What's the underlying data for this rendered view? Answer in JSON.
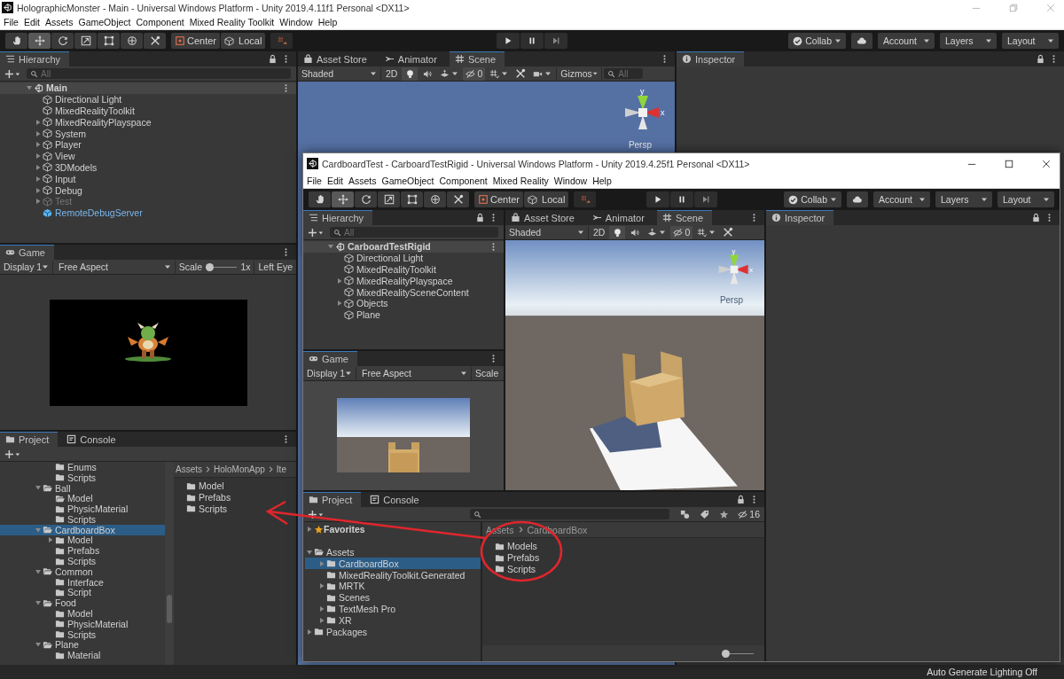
{
  "back_window": {
    "title": "HolographicMonster - Main - Universal Windows Platform - Unity 2019.4.11f1 Personal <DX11>",
    "menu": [
      "File",
      "Edit",
      "Assets",
      "GameObject",
      "Component",
      "Mixed Reality Toolkit",
      "Window",
      "Help"
    ],
    "tools": [
      {
        "kind": "hand",
        "selected": false
      },
      {
        "kind": "move",
        "selected": true
      },
      {
        "kind": "rotate",
        "selected": false
      },
      {
        "kind": "scale",
        "selected": false
      },
      {
        "kind": "rect",
        "selected": false
      },
      {
        "kind": "transform",
        "selected": false
      },
      {
        "kind": "custom",
        "selected": false
      }
    ],
    "pivot": "Center",
    "space": "Local",
    "collab": "Collab",
    "account": "Account",
    "layers": "Layers",
    "layout": "Layout",
    "hierarchy": {
      "title": "Hierarchy",
      "search_placeholder": "All",
      "scene": "Main",
      "items": [
        {
          "label": "Directional Light",
          "kind": "object",
          "disabled": false,
          "selected": false
        },
        {
          "label": "MixedRealityToolkit",
          "kind": "object",
          "disabled": false,
          "selected": false
        },
        {
          "label": "MixedRealityPlayspace",
          "kind": "object",
          "expanded": false,
          "disabled": false,
          "selected": false
        },
        {
          "label": "System",
          "kind": "object",
          "expanded": false,
          "disabled": false,
          "selected": false
        },
        {
          "label": "Player",
          "kind": "object",
          "expanded": false,
          "disabled": false,
          "selected": false
        },
        {
          "label": "View",
          "kind": "object",
          "expanded": false,
          "disabled": false,
          "selected": false
        },
        {
          "label": "3DModels",
          "kind": "object",
          "expanded": false,
          "disabled": false,
          "selected": false
        },
        {
          "label": "Input",
          "kind": "object",
          "expanded": false,
          "disabled": false,
          "selected": false
        },
        {
          "label": "Debug",
          "kind": "object",
          "expanded": false,
          "disabled": false,
          "selected": false
        },
        {
          "label": "Test",
          "kind": "object",
          "expanded": false,
          "disabled": true,
          "selected": false
        },
        {
          "label": "RemoteDebugServer",
          "kind": "prefab",
          "disabled": false,
          "selected": false
        }
      ]
    },
    "scene": {
      "tabs": [
        {
          "label": "Asset Store",
          "kind": "store",
          "selected": false
        },
        {
          "label": "Animator",
          "kind": "animator",
          "selected": false
        },
        {
          "label": "Scene",
          "kind": "scene",
          "selected": true
        }
      ],
      "shading": "Shaded",
      "mode": "2D",
      "hidden_count": "0",
      "gizmos": "Gizmos",
      "search_placeholder": "All",
      "axis_y": "y",
      "axis_x": "x",
      "camera": "Persp"
    },
    "game": {
      "title": "Game",
      "display": "Display 1",
      "aspect": "Free Aspect",
      "scale_label": "Scale",
      "scale_slider": {
        "level": 0
      },
      "scale_value": "1x",
      "eye": "Left Eye"
    },
    "project": {
      "tabs": [
        {
          "label": "Project",
          "kind": "project",
          "selected": true
        },
        {
          "label": "Console",
          "kind": "console",
          "selected": false
        }
      ],
      "tree": [
        {
          "children": [
            {
              "label": "Enums",
              "selected": false
            },
            {
              "label": "Scripts",
              "selected": false
            }
          ]
        },
        {
          "label": "Ball",
          "expanded": true,
          "selected": false,
          "children": [
            {
              "label": "Model",
              "open": true,
              "selected": false
            },
            {
              "label": "PhysicMaterial",
              "selected": false
            },
            {
              "label": "Scripts",
              "selected": false
            }
          ]
        },
        {
          "label": "CardboardBox",
          "expanded": true,
          "selected": true,
          "children": [
            {
              "label": "Model",
              "expanded": false,
              "selected": false
            },
            {
              "label": "Prefabs",
              "selected": false
            },
            {
              "label": "Scripts",
              "selected": false
            }
          ]
        },
        {
          "label": "Common",
          "expanded": true,
          "selected": false,
          "children": [
            {
              "label": "Interface",
              "selected": false
            },
            {
              "label": "Script",
              "selected": false
            }
          ]
        },
        {
          "label": "Food",
          "expanded": true,
          "selected": false,
          "children": [
            {
              "label": "Model",
              "selected": false
            },
            {
              "label": "PhysicMaterial",
              "selected": false
            },
            {
              "label": "Scripts",
              "selected": false
            }
          ]
        },
        {
          "label": "Plane",
          "expanded": true,
          "selected": false,
          "children": [
            {
              "label": "Material",
              "selected": false
            }
          ]
        }
      ],
      "breadcrumb": [
        "Assets",
        "HoloMonApp",
        "Ite"
      ],
      "files": [
        "Model",
        "Prefabs",
        "Scripts"
      ]
    },
    "inspector": {
      "title": "Inspector"
    },
    "status": "Auto Generate Lighting Off"
  },
  "front_window": {
    "title": "CardboardTest - CarboardTestRigid - Universal Windows Platform - Unity 2019.4.25f1 Personal <DX11>",
    "menu": [
      "File",
      "Edit",
      "Assets",
      "GameObject",
      "Component",
      "Mixed Reality",
      "Window",
      "Help"
    ],
    "tools": [
      {
        "kind": "hand",
        "selected": false
      },
      {
        "kind": "move",
        "selected": true
      },
      {
        "kind": "rotate",
        "selected": false
      },
      {
        "kind": "scale",
        "selected": false
      },
      {
        "kind": "rect",
        "selected": false
      },
      {
        "kind": "transform",
        "selected": false
      },
      {
        "kind": "custom",
        "selected": false
      }
    ],
    "pivot": "Center",
    "space": "Local",
    "collab": "Collab",
    "account": "Account",
    "layers": "Layers",
    "layout": "Layout",
    "hierarchy": {
      "title": "Hierarchy",
      "search_placeholder": "All",
      "scene": "CarboardTestRigid",
      "items": [
        {
          "label": "Directional Light",
          "kind": "object",
          "disabled": false,
          "selected": false
        },
        {
          "label": "MixedRealityToolkit",
          "kind": "object",
          "disabled": false,
          "selected": false
        },
        {
          "label": "MixedRealityPlayspace",
          "kind": "object",
          "expanded": false,
          "disabled": false,
          "selected": false
        },
        {
          "label": "MixedRealitySceneContent",
          "kind": "object",
          "disabled": false,
          "selected": false
        },
        {
          "label": "Objects",
          "kind": "object",
          "expanded": false,
          "disabled": false,
          "selected": false
        },
        {
          "label": "Plane",
          "kind": "object",
          "disabled": false,
          "selected": false
        }
      ]
    },
    "scene": {
      "tabs": [
        {
          "label": "Asset Store",
          "kind": "store",
          "selected": false
        },
        {
          "label": "Animator",
          "kind": "animator",
          "selected": false
        },
        {
          "label": "Scene",
          "kind": "scene",
          "selected": true
        }
      ],
      "shading": "Shaded",
      "mode": "2D",
      "hidden_count": "0",
      "axis_y": "y",
      "axis_x": "x",
      "camera": "Persp"
    },
    "game": {
      "title": "Game",
      "display": "Display 1",
      "aspect": "Free Aspect",
      "scale_label": "Scale"
    },
    "project": {
      "tabs": [
        {
          "label": "Project",
          "kind": "project",
          "selected": true
        },
        {
          "label": "Console",
          "kind": "console",
          "selected": false
        }
      ],
      "hidden_count": "16",
      "favorites": {
        "label": "Favorites",
        "expanded": false
      },
      "tree": [
        {
          "label": "Assets",
          "expanded": true,
          "selected": false,
          "children": [
            {
              "label": "CardboardBox",
              "expanded": false,
              "selected": true
            },
            {
              "label": "MixedRealityToolkit.Generated",
              "selected": false
            },
            {
              "label": "MRTK",
              "expanded": false,
              "selected": false
            },
            {
              "label": "Scenes",
              "selected": false
            },
            {
              "label": "TextMesh Pro",
              "expanded": false,
              "selected": false
            },
            {
              "label": "XR",
              "expanded": false,
              "selected": false
            }
          ]
        },
        {
          "label": "Packages",
          "expanded": false,
          "selected": false
        }
      ],
      "breadcrumb": [
        "Assets",
        "CardboardBox"
      ],
      "files": [
        "Models",
        "Prefabs",
        "Scripts"
      ],
      "icon_size_slider": {
        "level": 0
      }
    },
    "inspector": {
      "title": "Inspector"
    }
  }
}
